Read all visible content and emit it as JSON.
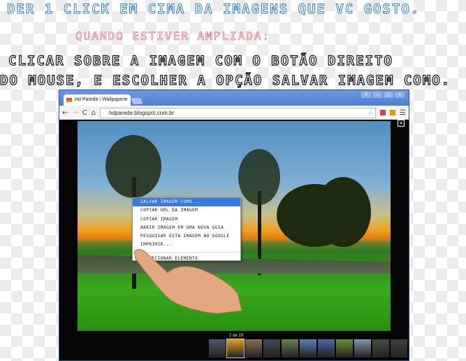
{
  "caption": {
    "line1": "DER 1 CLICK EM CIMA DA IMAGENS QUE VC GOSTO.",
    "line2": "QUANDO ESTIVER AMPLIADA:",
    "line3": "CLICAR SOBRE A IMAGEM COM O BOTÃO DIREITO",
    "line4": "DO MOUSE, E ESCOLHER A OPÇÃO SALVAR IMAGEM COMO."
  },
  "browser": {
    "tab_title": "Hd Parede \\ Wallpapers",
    "tab_close": "×",
    "url": "hdparede.blogspot.com.br",
    "back": "←",
    "forward": "→",
    "reload": "C",
    "home": "⌂",
    "star": "☆",
    "menu": "☰",
    "window_controls": [
      "≜",
      "–",
      "□",
      "×"
    ]
  },
  "viewer": {
    "close": "✕",
    "counter": "2 de 19",
    "thumbnail_colors": [
      "#505868",
      "#e0a020",
      "#8a7050",
      "#404a58",
      "#6a8050",
      "#5a80b0",
      "#4a68a0",
      "#6a9030",
      "#8098b0",
      "#405040",
      "#404040"
    ]
  },
  "context_menu": {
    "items": [
      "SALVAR IMAGEM COMO...",
      "COPIAR URL DA IMAGEM",
      "COPIAR IMAGEM",
      "ABRIR IMAGEM EM UMA NOVA GUIA",
      "PESQUISAR ESTA IMAGEM NO GOOGLE",
      "IMPRIMIR...",
      "INSPECIONAR ELEMENTO"
    ]
  }
}
